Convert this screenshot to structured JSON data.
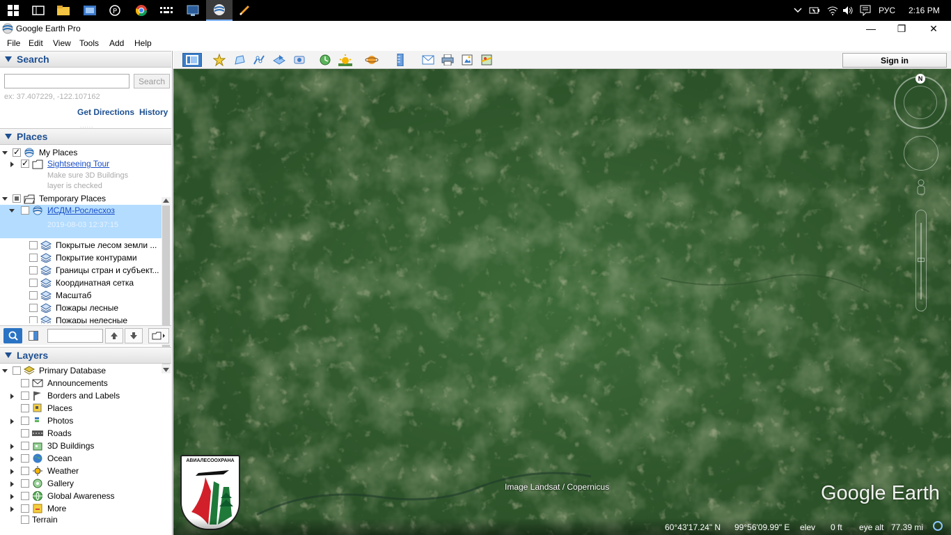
{
  "taskbar": {
    "icons": [
      "windows-start-icon",
      "task-view-icon",
      "file-explorer-icon",
      "settings-panel-icon",
      "app-p-icon",
      "chrome-icon",
      "keyboard-app-icon",
      "screen-app-icon",
      "google-earth-icon",
      "pen-app-icon"
    ],
    "language": "РУС",
    "time": "2:16 PM"
  },
  "window": {
    "title": "Google Earth Pro",
    "controls": {
      "minimize": "—",
      "maximize": "❐",
      "close": "✕"
    }
  },
  "menu": {
    "file": "File",
    "edit": "Edit",
    "view": "View",
    "tools": "Tools",
    "add": "Add",
    "help": "Help"
  },
  "search": {
    "header": "Search",
    "placeholder": "",
    "button": "Search",
    "example": "ex: 37.407229, -122.107162",
    "get_directions": "Get Directions",
    "history": "History"
  },
  "places": {
    "header": "Places",
    "my_places": "My Places",
    "sightseeing": "Sightseeing Tour",
    "sightseeing_note1": "Make sure 3D Buildings",
    "sightseeing_note2": "layer is checked",
    "temporary": "Temporary Places",
    "selected_item": "ИСДМ-Рослесхоз",
    "selected_date": "2019-08-03 12:37:15",
    "children": [
      "Покрытые лесом земли ...",
      "Покрытие контурами",
      "Границы стран и субъект...",
      "Координатная сетка",
      "Масштаб",
      "Пожары лесные",
      "Пожары нелесные"
    ]
  },
  "layers": {
    "header": "Layers",
    "primary": "Primary Database",
    "items": [
      {
        "label": "Announcements",
        "expand": false,
        "icon": "envelope-icon"
      },
      {
        "label": "Borders and Labels",
        "expand": true,
        "icon": "flag-icon"
      },
      {
        "label": "Places",
        "expand": false,
        "icon": "places-square-icon"
      },
      {
        "label": "Photos",
        "expand": true,
        "icon": "photo-icon"
      },
      {
        "label": "Roads",
        "expand": false,
        "icon": "road-icon"
      },
      {
        "label": "3D Buildings",
        "expand": true,
        "icon": "building-icon"
      },
      {
        "label": "Ocean",
        "expand": true,
        "icon": "ocean-globe-icon"
      },
      {
        "label": "Weather",
        "expand": true,
        "icon": "sun-icon"
      },
      {
        "label": "Gallery",
        "expand": true,
        "icon": "gallery-icon"
      },
      {
        "label": "Global Awareness",
        "expand": true,
        "icon": "globe-icon"
      },
      {
        "label": "More",
        "expand": true,
        "icon": "more-icon"
      }
    ],
    "terrain": "Terrain"
  },
  "toolbar": {
    "sign_in": "Sign in",
    "tools": [
      "sidebar-toggle-icon",
      "add-placemark-icon",
      "add-polygon-icon",
      "add-path-icon",
      "image-overlay-icon",
      "record-tour-icon",
      "historical-imagery-icon",
      "sunlight-icon",
      "planets-icon",
      "ruler-icon",
      "email-icon",
      "print-icon",
      "save-image-icon",
      "view-in-maps-icon"
    ]
  },
  "map": {
    "attribution": "Image Landsat / Copernicus",
    "brand": "Google Earth",
    "logo_text": "АВИАЛЕСООХРАНА",
    "compass_north": "N",
    "status": {
      "lat": "60°43'17.24\" N",
      "lon": "99°56'09.99\" E",
      "elev_label": "elev",
      "elev_value": "0 ft",
      "eye_label": "eye alt",
      "eye_value": "77.39 mi"
    }
  },
  "colors": {
    "accent": "#1d4f91",
    "selection": "#b3dcff",
    "forest": "#2f5a2e"
  }
}
